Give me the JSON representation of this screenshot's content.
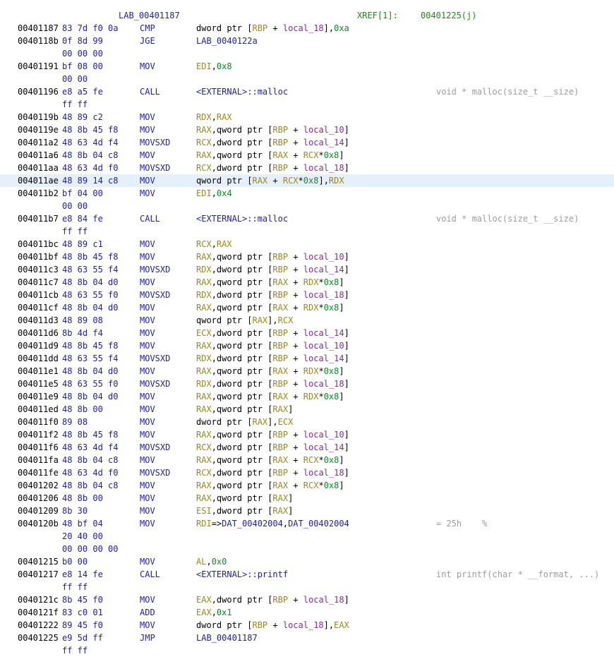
{
  "colors": {
    "address": "#000000",
    "bytes": "#1f1fa6",
    "mnemonic": "#1f1fa6",
    "register": "#9a8a1c",
    "local": "#8a2a9c",
    "hex": "#0f8a2a",
    "reference": "#1f1fa6",
    "comment": "#9c9c9c",
    "xref": "#1a8c1a",
    "highlight": "#e6f0fb"
  },
  "header": {
    "label": "LAB_00401187",
    "xref_label": "XREF[1]:",
    "xref_target": "00401225(j)"
  },
  "rows": [
    {
      "addr": "00401187",
      "bytes": "83 7d f0 0a",
      "mnem": "CMP",
      "ops": [
        [
          "txt",
          "dword ptr ["
        ],
        [
          "reg",
          "RBP"
        ],
        [
          "txt",
          " + "
        ],
        [
          "local",
          "local_18"
        ],
        [
          "txt",
          "],"
        ],
        [
          "hex",
          "0xa"
        ]
      ]
    },
    {
      "addr": "0040118b",
      "bytes": "0f 8d 99",
      "mnem": "JGE",
      "ops": [
        [
          "ref",
          "LAB_0040122a"
        ]
      ]
    },
    {
      "addr": "",
      "bytes": "00 00 00",
      "mnem": "",
      "ops": []
    },
    {
      "addr": "00401191",
      "bytes": "bf 08 00",
      "mnem": "MOV",
      "ops": [
        [
          "reg",
          "EDI"
        ],
        [
          "txt",
          ","
        ],
        [
          "hex",
          "0x8"
        ]
      ]
    },
    {
      "addr": "",
      "bytes": "00 00",
      "mnem": "",
      "ops": []
    },
    {
      "addr": "00401196",
      "bytes": "e8 a5 fe",
      "mnem": "CALL",
      "ops": [
        [
          "ref",
          "<EXTERNAL>::malloc"
        ]
      ],
      "comment": "void * malloc(size_t __size)"
    },
    {
      "addr": "",
      "bytes": "ff ff",
      "mnem": "",
      "ops": []
    },
    {
      "addr": "0040119b",
      "bytes": "48 89 c2",
      "mnem": "MOV",
      "ops": [
        [
          "reg",
          "RDX"
        ],
        [
          "txt",
          ","
        ],
        [
          "reg",
          "RAX"
        ]
      ]
    },
    {
      "addr": "0040119e",
      "bytes": "48 8b 45 f8",
      "mnem": "MOV",
      "ops": [
        [
          "reg",
          "RAX"
        ],
        [
          "txt",
          ",qword ptr ["
        ],
        [
          "reg",
          "RBP"
        ],
        [
          "txt",
          " + "
        ],
        [
          "local",
          "local_10"
        ],
        [
          "txt",
          "]"
        ]
      ]
    },
    {
      "addr": "004011a2",
      "bytes": "48 63 4d f4",
      "mnem": "MOVSXD",
      "ops": [
        [
          "reg",
          "RCX"
        ],
        [
          "txt",
          ",dword ptr ["
        ],
        [
          "reg",
          "RBP"
        ],
        [
          "txt",
          " + "
        ],
        [
          "local",
          "local_14"
        ],
        [
          "txt",
          "]"
        ]
      ]
    },
    {
      "addr": "004011a6",
      "bytes": "48 8b 04 c8",
      "mnem": "MOV",
      "ops": [
        [
          "reg",
          "RAX"
        ],
        [
          "txt",
          ",qword ptr ["
        ],
        [
          "reg",
          "RAX"
        ],
        [
          "txt",
          " + "
        ],
        [
          "reg",
          "RCX"
        ],
        [
          "txt",
          "*"
        ],
        [
          "hex",
          "0x8"
        ],
        [
          "txt",
          "]"
        ]
      ]
    },
    {
      "addr": "004011aa",
      "bytes": "48 63 4d f0",
      "mnem": "MOVSXD",
      "ops": [
        [
          "reg",
          "RCX"
        ],
        [
          "txt",
          ",dword ptr ["
        ],
        [
          "reg",
          "RBP"
        ],
        [
          "txt",
          " + "
        ],
        [
          "local",
          "local_18"
        ],
        [
          "txt",
          "]"
        ]
      ]
    },
    {
      "addr": "004011ae",
      "bytes": "48 89 14 c8",
      "mnem": "MOV",
      "highlight": true,
      "ops": [
        [
          "txt",
          "qword ptr ["
        ],
        [
          "reg",
          "RAX"
        ],
        [
          "txt",
          " + "
        ],
        [
          "reg",
          "RCX"
        ],
        [
          "txt",
          "*"
        ],
        [
          "hex",
          "0x8"
        ],
        [
          "txt",
          "],"
        ],
        [
          "reg",
          "RDX"
        ]
      ]
    },
    {
      "addr": "004011b2",
      "bytes": "bf 04 00",
      "mnem": "MOV",
      "ops": [
        [
          "reg",
          "EDI"
        ],
        [
          "txt",
          ","
        ],
        [
          "hex",
          "0x4"
        ]
      ]
    },
    {
      "addr": "",
      "bytes": "00 00",
      "mnem": "",
      "ops": []
    },
    {
      "addr": "004011b7",
      "bytes": "e8 84 fe",
      "mnem": "CALL",
      "ops": [
        [
          "ref",
          "<EXTERNAL>::malloc"
        ]
      ],
      "comment": "void * malloc(size_t __size)"
    },
    {
      "addr": "",
      "bytes": "ff ff",
      "mnem": "",
      "ops": []
    },
    {
      "addr": "004011bc",
      "bytes": "48 89 c1",
      "mnem": "MOV",
      "ops": [
        [
          "reg",
          "RCX"
        ],
        [
          "txt",
          ","
        ],
        [
          "reg",
          "RAX"
        ]
      ]
    },
    {
      "addr": "004011bf",
      "bytes": "48 8b 45 f8",
      "mnem": "MOV",
      "ops": [
        [
          "reg",
          "RAX"
        ],
        [
          "txt",
          ",qword ptr ["
        ],
        [
          "reg",
          "RBP"
        ],
        [
          "txt",
          " + "
        ],
        [
          "local",
          "local_10"
        ],
        [
          "txt",
          "]"
        ]
      ]
    },
    {
      "addr": "004011c3",
      "bytes": "48 63 55 f4",
      "mnem": "MOVSXD",
      "ops": [
        [
          "reg",
          "RDX"
        ],
        [
          "txt",
          ",dword ptr ["
        ],
        [
          "reg",
          "RBP"
        ],
        [
          "txt",
          " + "
        ],
        [
          "local",
          "local_14"
        ],
        [
          "txt",
          "]"
        ]
      ]
    },
    {
      "addr": "004011c7",
      "bytes": "48 8b 04 d0",
      "mnem": "MOV",
      "ops": [
        [
          "reg",
          "RAX"
        ],
        [
          "txt",
          ",qword ptr ["
        ],
        [
          "reg",
          "RAX"
        ],
        [
          "txt",
          " + "
        ],
        [
          "reg",
          "RDX"
        ],
        [
          "txt",
          "*"
        ],
        [
          "hex",
          "0x8"
        ],
        [
          "txt",
          "]"
        ]
      ]
    },
    {
      "addr": "004011cb",
      "bytes": "48 63 55 f0",
      "mnem": "MOVSXD",
      "ops": [
        [
          "reg",
          "RDX"
        ],
        [
          "txt",
          ",dword ptr ["
        ],
        [
          "reg",
          "RBP"
        ],
        [
          "txt",
          " + "
        ],
        [
          "local",
          "local_18"
        ],
        [
          "txt",
          "]"
        ]
      ]
    },
    {
      "addr": "004011cf",
      "bytes": "48 8b 04 d0",
      "mnem": "MOV",
      "ops": [
        [
          "reg",
          "RAX"
        ],
        [
          "txt",
          ",qword ptr ["
        ],
        [
          "reg",
          "RAX"
        ],
        [
          "txt",
          " + "
        ],
        [
          "reg",
          "RDX"
        ],
        [
          "txt",
          "*"
        ],
        [
          "hex",
          "0x8"
        ],
        [
          "txt",
          "]"
        ]
      ]
    },
    {
      "addr": "004011d3",
      "bytes": "48 89 08",
      "mnem": "MOV",
      "ops": [
        [
          "txt",
          "qword ptr ["
        ],
        [
          "reg",
          "RAX"
        ],
        [
          "txt",
          "],"
        ],
        [
          "reg",
          "RCX"
        ]
      ]
    },
    {
      "addr": "004011d6",
      "bytes": "8b 4d f4",
      "mnem": "MOV",
      "ops": [
        [
          "reg",
          "ECX"
        ],
        [
          "txt",
          ",dword ptr ["
        ],
        [
          "reg",
          "RBP"
        ],
        [
          "txt",
          " + "
        ],
        [
          "local",
          "local_14"
        ],
        [
          "txt",
          "]"
        ]
      ]
    },
    {
      "addr": "004011d9",
      "bytes": "48 8b 45 f8",
      "mnem": "MOV",
      "ops": [
        [
          "reg",
          "RAX"
        ],
        [
          "txt",
          ",qword ptr ["
        ],
        [
          "reg",
          "RBP"
        ],
        [
          "txt",
          " + "
        ],
        [
          "local",
          "local_10"
        ],
        [
          "txt",
          "]"
        ]
      ]
    },
    {
      "addr": "004011dd",
      "bytes": "48 63 55 f4",
      "mnem": "MOVSXD",
      "ops": [
        [
          "reg",
          "RDX"
        ],
        [
          "txt",
          ",dword ptr ["
        ],
        [
          "reg",
          "RBP"
        ],
        [
          "txt",
          " + "
        ],
        [
          "local",
          "local_14"
        ],
        [
          "txt",
          "]"
        ]
      ]
    },
    {
      "addr": "004011e1",
      "bytes": "48 8b 04 d0",
      "mnem": "MOV",
      "ops": [
        [
          "reg",
          "RAX"
        ],
        [
          "txt",
          ",qword ptr ["
        ],
        [
          "reg",
          "RAX"
        ],
        [
          "txt",
          " + "
        ],
        [
          "reg",
          "RDX"
        ],
        [
          "txt",
          "*"
        ],
        [
          "hex",
          "0x8"
        ],
        [
          "txt",
          "]"
        ]
      ]
    },
    {
      "addr": "004011e5",
      "bytes": "48 63 55 f0",
      "mnem": "MOVSXD",
      "ops": [
        [
          "reg",
          "RDX"
        ],
        [
          "txt",
          ",dword ptr ["
        ],
        [
          "reg",
          "RBP"
        ],
        [
          "txt",
          " + "
        ],
        [
          "local",
          "local_18"
        ],
        [
          "txt",
          "]"
        ]
      ]
    },
    {
      "addr": "004011e9",
      "bytes": "48 8b 04 d0",
      "mnem": "MOV",
      "ops": [
        [
          "reg",
          "RAX"
        ],
        [
          "txt",
          ",qword ptr ["
        ],
        [
          "reg",
          "RAX"
        ],
        [
          "txt",
          " + "
        ],
        [
          "reg",
          "RDX"
        ],
        [
          "txt",
          "*"
        ],
        [
          "hex",
          "0x8"
        ],
        [
          "txt",
          "]"
        ]
      ]
    },
    {
      "addr": "004011ed",
      "bytes": "48 8b 00",
      "mnem": "MOV",
      "ops": [
        [
          "reg",
          "RAX"
        ],
        [
          "txt",
          ",qword ptr ["
        ],
        [
          "reg",
          "RAX"
        ],
        [
          "txt",
          "]"
        ]
      ]
    },
    {
      "addr": "004011f0",
      "bytes": "89 08",
      "mnem": "MOV",
      "ops": [
        [
          "txt",
          "dword ptr ["
        ],
        [
          "reg",
          "RAX"
        ],
        [
          "txt",
          "],"
        ],
        [
          "reg",
          "ECX"
        ]
      ]
    },
    {
      "addr": "004011f2",
      "bytes": "48 8b 45 f8",
      "mnem": "MOV",
      "ops": [
        [
          "reg",
          "RAX"
        ],
        [
          "txt",
          ",qword ptr ["
        ],
        [
          "reg",
          "RBP"
        ],
        [
          "txt",
          " + "
        ],
        [
          "local",
          "local_10"
        ],
        [
          "txt",
          "]"
        ]
      ]
    },
    {
      "addr": "004011f6",
      "bytes": "48 63 4d f4",
      "mnem": "MOVSXD",
      "ops": [
        [
          "reg",
          "RCX"
        ],
        [
          "txt",
          ",dword ptr ["
        ],
        [
          "reg",
          "RBP"
        ],
        [
          "txt",
          " + "
        ],
        [
          "local",
          "local_14"
        ],
        [
          "txt",
          "]"
        ]
      ]
    },
    {
      "addr": "004011fa",
      "bytes": "48 8b 04 c8",
      "mnem": "MOV",
      "ops": [
        [
          "reg",
          "RAX"
        ],
        [
          "txt",
          ",qword ptr ["
        ],
        [
          "reg",
          "RAX"
        ],
        [
          "txt",
          " + "
        ],
        [
          "reg",
          "RCX"
        ],
        [
          "txt",
          "*"
        ],
        [
          "hex",
          "0x8"
        ],
        [
          "txt",
          "]"
        ]
      ]
    },
    {
      "addr": "004011fe",
      "bytes": "48 63 4d f0",
      "mnem": "MOVSXD",
      "ops": [
        [
          "reg",
          "RCX"
        ],
        [
          "txt",
          ",dword ptr ["
        ],
        [
          "reg",
          "RBP"
        ],
        [
          "txt",
          " + "
        ],
        [
          "local",
          "local_18"
        ],
        [
          "txt",
          "]"
        ]
      ]
    },
    {
      "addr": "00401202",
      "bytes": "48 8b 04 c8",
      "mnem": "MOV",
      "ops": [
        [
          "reg",
          "RAX"
        ],
        [
          "txt",
          ",qword ptr ["
        ],
        [
          "reg",
          "RAX"
        ],
        [
          "txt",
          " + "
        ],
        [
          "reg",
          "RCX"
        ],
        [
          "txt",
          "*"
        ],
        [
          "hex",
          "0x8"
        ],
        [
          "txt",
          "]"
        ]
      ]
    },
    {
      "addr": "00401206",
      "bytes": "48 8b 00",
      "mnem": "MOV",
      "ops": [
        [
          "reg",
          "RAX"
        ],
        [
          "txt",
          ",qword ptr ["
        ],
        [
          "reg",
          "RAX"
        ],
        [
          "txt",
          "]"
        ]
      ]
    },
    {
      "addr": "00401209",
      "bytes": "8b 30",
      "mnem": "MOV",
      "ops": [
        [
          "reg",
          "ESI"
        ],
        [
          "txt",
          ",dword ptr ["
        ],
        [
          "reg",
          "RAX"
        ],
        [
          "txt",
          "]"
        ]
      ]
    },
    {
      "addr": "0040120b",
      "bytes": "48 bf 04",
      "mnem": "MOV",
      "ops": [
        [
          "reg",
          "RDI"
        ],
        [
          "txt",
          "=>"
        ],
        [
          "ref",
          "DAT_00402004"
        ],
        [
          "txt",
          ","
        ],
        [
          "ref",
          "DAT_00402004"
        ]
      ],
      "comment": "= 25h    %"
    },
    {
      "addr": "",
      "bytes": "20 40 00",
      "mnem": "",
      "ops": []
    },
    {
      "addr": "",
      "bytes": "00 00 00 00",
      "mnem": "",
      "ops": []
    },
    {
      "addr": "00401215",
      "bytes": "b0 00",
      "mnem": "MOV",
      "ops": [
        [
          "reg",
          "AL"
        ],
        [
          "txt",
          ","
        ],
        [
          "hex",
          "0x0"
        ]
      ]
    },
    {
      "addr": "00401217",
      "bytes": "e8 14 fe",
      "mnem": "CALL",
      "ops": [
        [
          "ref",
          "<EXTERNAL>::printf"
        ]
      ],
      "comment": "int printf(char * __format, ...)"
    },
    {
      "addr": "",
      "bytes": "ff ff",
      "mnem": "",
      "ops": []
    },
    {
      "addr": "0040121c",
      "bytes": "8b 45 f0",
      "mnem": "MOV",
      "ops": [
        [
          "reg",
          "EAX"
        ],
        [
          "txt",
          ",dword ptr ["
        ],
        [
          "reg",
          "RBP"
        ],
        [
          "txt",
          " + "
        ],
        [
          "local",
          "local_18"
        ],
        [
          "txt",
          "]"
        ]
      ]
    },
    {
      "addr": "0040121f",
      "bytes": "83 c0 01",
      "mnem": "ADD",
      "ops": [
        [
          "reg",
          "EAX"
        ],
        [
          "txt",
          ","
        ],
        [
          "hex",
          "0x1"
        ]
      ]
    },
    {
      "addr": "00401222",
      "bytes": "89 45 f0",
      "mnem": "MOV",
      "ops": [
        [
          "txt",
          "dword ptr ["
        ],
        [
          "reg",
          "RBP"
        ],
        [
          "txt",
          " + "
        ],
        [
          "local",
          "local_18"
        ],
        [
          "txt",
          "],"
        ],
        [
          "reg",
          "EAX"
        ]
      ]
    },
    {
      "addr": "00401225",
      "bytes": "e9 5d ff",
      "mnem": "JMP",
      "ops": [
        [
          "ref",
          "LAB_00401187"
        ]
      ]
    },
    {
      "addr": "",
      "bytes": "ff ff",
      "mnem": "",
      "ops": []
    }
  ]
}
